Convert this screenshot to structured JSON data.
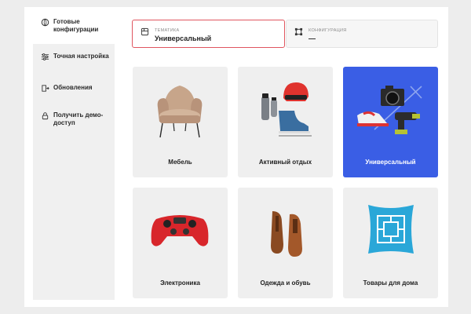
{
  "sidebar": {
    "items": [
      {
        "label": "Готовые конфигурации",
        "icon": "globe-icon"
      },
      {
        "label": "Точная настройка",
        "icon": "sliders-icon"
      },
      {
        "label": "Обновления",
        "icon": "refresh-icon"
      },
      {
        "label": "Получить демо-доступ",
        "icon": "lock-icon"
      }
    ]
  },
  "selectors": {
    "theme": {
      "label": "ТЕМАТИКА",
      "value": "Универсальный",
      "icon": "cube-icon"
    },
    "config": {
      "label": "КОНФИГУРАЦИЯ",
      "value": "—",
      "icon": "frame-icon"
    }
  },
  "cards": [
    {
      "label": "Мебель",
      "icon": "armchair-icon",
      "selected": false
    },
    {
      "label": "Активный отдых",
      "icon": "sport-gear-icon",
      "selected": false
    },
    {
      "label": "Универсальный",
      "icon": "mixed-products-icon",
      "selected": true
    },
    {
      "label": "Электроника",
      "icon": "gamepad-icon",
      "selected": false
    },
    {
      "label": "Одежда и обувь",
      "icon": "shoes-icon",
      "selected": false
    },
    {
      "label": "Товары для дома",
      "icon": "pillow-icon",
      "selected": false
    }
  ],
  "colors": {
    "accent": "#3a5ee5",
    "highlight_border": "#e0565f",
    "card_bg": "#efefef"
  }
}
